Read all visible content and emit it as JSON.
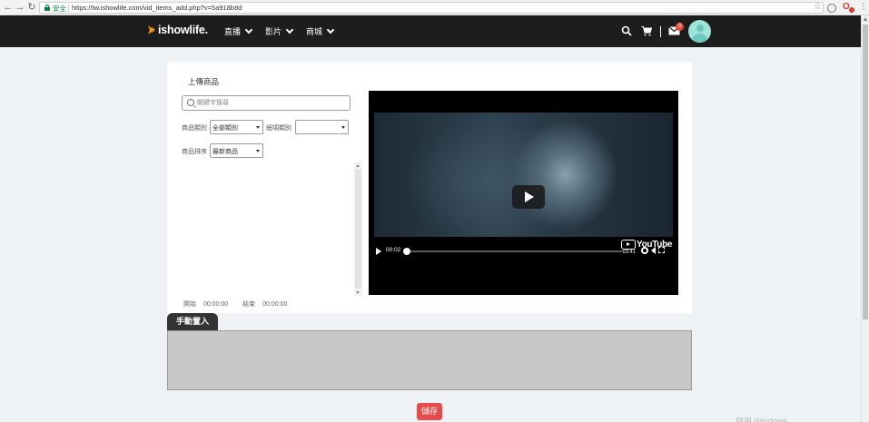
{
  "browser": {
    "security_label": "安全",
    "url": "https://tw.ishowlife.com/vid_items_add.php?v=5a918b8d",
    "back_icon": "arrow-left-icon",
    "forward_icon": "arrow-right-icon",
    "reload_icon": "reload-icon",
    "extension_badge": "1"
  },
  "header": {
    "logo_text": "ishowlife.",
    "nav": [
      {
        "label": "直播"
      },
      {
        "label": "影片"
      },
      {
        "label": "商城"
      }
    ],
    "mail_badge": "0",
    "colors": {
      "bg": "#1d1d1d",
      "logo_accent": "#f7a21b",
      "avatar": "#9ee4d8",
      "badge": "#e74c3c"
    }
  },
  "form": {
    "title": "上傳商品",
    "search_placeholder": "關鍵字搜尋",
    "category_label": "商品類別",
    "category_value": "全部類別",
    "subcategory_label": "細項類別",
    "subcategory_value": "",
    "sort_label": "商品排序",
    "sort_value": "最新商品",
    "start_label": "開始",
    "start_time": "00:00:00",
    "end_label": "結束",
    "end_time": "00:00:00"
  },
  "video": {
    "current_time": "00:02",
    "duration": "03:41",
    "progress": 0.01,
    "logo_text": "YouTube"
  },
  "manual": {
    "tab_label": "手動置入"
  },
  "actions": {
    "save_label": "儲存",
    "save_color": "#e84a4a"
  },
  "os_watermark": "啟用 Windows"
}
